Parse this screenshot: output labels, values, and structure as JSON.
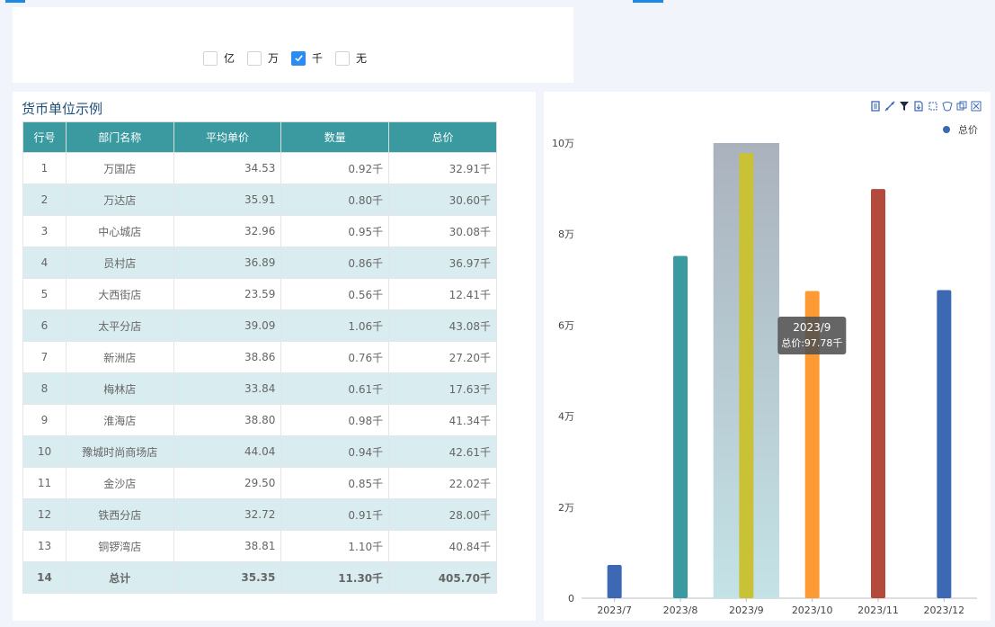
{
  "units": {
    "options": [
      {
        "label": "亿",
        "checked": false
      },
      {
        "label": "万",
        "checked": false
      },
      {
        "label": "千",
        "checked": true
      },
      {
        "label": "无",
        "checked": false
      }
    ]
  },
  "table": {
    "title": "货币单位示例",
    "headers": [
      "行号",
      "部门名称",
      "平均单价",
      "数量",
      "总价"
    ],
    "rows": [
      [
        "1",
        "万国店",
        "34.53",
        "0.92千",
        "32.91千"
      ],
      [
        "2",
        "万达店",
        "35.91",
        "0.80千",
        "30.60千"
      ],
      [
        "3",
        "中心城店",
        "32.96",
        "0.95千",
        "30.08千"
      ],
      [
        "4",
        "员村店",
        "36.89",
        "0.86千",
        "36.97千"
      ],
      [
        "5",
        "大西街店",
        "23.59",
        "0.56千",
        "12.41千"
      ],
      [
        "6",
        "太平分店",
        "39.09",
        "1.06千",
        "43.08千"
      ],
      [
        "7",
        "新洲店",
        "38.86",
        "0.76千",
        "27.20千"
      ],
      [
        "8",
        "梅林店",
        "33.84",
        "0.61千",
        "17.63千"
      ],
      [
        "9",
        "淮海店",
        "38.80",
        "0.98千",
        "41.34千"
      ],
      [
        "10",
        "豫城时尚商场店",
        "44.04",
        "0.94千",
        "42.61千"
      ],
      [
        "11",
        "金沙店",
        "29.50",
        "0.85千",
        "22.02千"
      ],
      [
        "12",
        "铁西分店",
        "32.72",
        "0.91千",
        "28.00千"
      ],
      [
        "13",
        "铜锣湾店",
        "38.81",
        "1.10千",
        "40.84千"
      ]
    ],
    "total": [
      "14",
      "总计",
      "35.35",
      "11.30千",
      "405.70千"
    ]
  },
  "chart": {
    "legend_label": "总价",
    "tooltip_title": "2023/9",
    "tooltip_value": "总价:97.78千",
    "toolbar_icons": [
      "data-view-icon",
      "line-switch-icon",
      "filter-icon",
      "export-icon",
      "rect-select-icon",
      "lasso-select-icon",
      "keep-select-icon",
      "clear-select-icon"
    ]
  },
  "chart_data": {
    "type": "bar",
    "categories": [
      "2023/7",
      "2023/8",
      "2023/9",
      "2023/10",
      "2023/11",
      "2023/12"
    ],
    "series": [
      {
        "name": "总价",
        "values": [
          7.3,
          75.2,
          97.78,
          67.5,
          89.9,
          67.7
        ]
      }
    ],
    "colors": [
      "#3d68b4",
      "#3a9aa0",
      "#c9c237",
      "#fd9a33",
      "#b44a3b",
      "#3d68b4"
    ],
    "y_ticks": [
      "0",
      "2万",
      "4万",
      "6万",
      "8万",
      "10万"
    ],
    "ylim": [
      0,
      100
    ],
    "highlighted": "2023/9"
  }
}
